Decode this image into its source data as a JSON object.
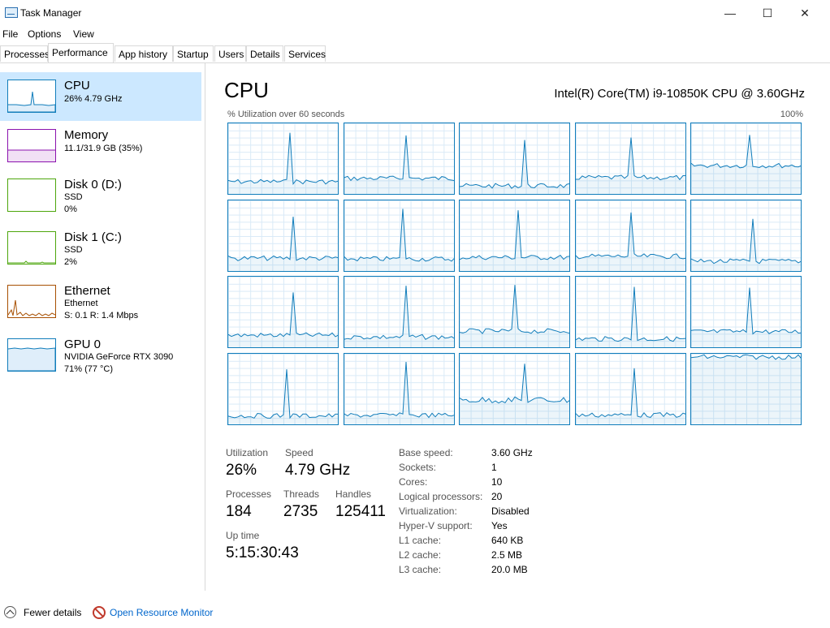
{
  "window": {
    "title": "Task Manager",
    "controls": [
      "—",
      "☐",
      "✕"
    ]
  },
  "menu": [
    "File",
    "Options",
    "View"
  ],
  "tabs": [
    "Processes",
    "Performance",
    "App history",
    "Startup",
    "Users",
    "Details",
    "Services"
  ],
  "active_tab": "Performance",
  "sidebar": [
    {
      "title": "CPU",
      "line1": "26%  4.79 GHz",
      "color": "#117dbb"
    },
    {
      "title": "Memory",
      "line1": "11.1/31.9 GB (35%)",
      "color": "#8b12ae"
    },
    {
      "title": "Disk 0 (D:)",
      "line1": "SSD",
      "line2": "0%",
      "color": "#4da60c"
    },
    {
      "title": "Disk 1 (C:)",
      "line1": "SSD",
      "line2": "2%",
      "color": "#4da60c"
    },
    {
      "title": "Ethernet",
      "line1": "Ethernet",
      "line2": "S: 0.1  R: 1.4 Mbps",
      "color": "#a74f01"
    },
    {
      "title": "GPU 0",
      "line1": "NVIDIA GeForce RTX 3090",
      "line2": "71% (77 °C)",
      "color": "#117dbb"
    }
  ],
  "main": {
    "heading": "CPU",
    "model": "Intel(R) Core(TM) i9-10850K CPU @ 3.60GHz",
    "util_caption": "% Utilization over 60 seconds",
    "max_label": "100%",
    "graph_color": "#117dbb",
    "cores": 20
  },
  "stats": {
    "utilization": {
      "label": "Utilization",
      "value": "26%"
    },
    "speed": {
      "label": "Speed",
      "value": "4.79 GHz"
    },
    "processes": {
      "label": "Processes",
      "value": "184"
    },
    "threads": {
      "label": "Threads",
      "value": "2735"
    },
    "handles": {
      "label": "Handles",
      "value": "125411"
    },
    "uptime": {
      "label": "Up time",
      "value": "5:15:30:43"
    }
  },
  "details": [
    {
      "label": "Base speed:",
      "value": "3.60 GHz"
    },
    {
      "label": "Sockets:",
      "value": "1"
    },
    {
      "label": "Cores:",
      "value": "10"
    },
    {
      "label": "Logical processors:",
      "value": "20"
    },
    {
      "label": "Virtualization:",
      "value": "Disabled"
    },
    {
      "label": "Hyper-V support:",
      "value": "Yes"
    },
    {
      "label": "L1 cache:",
      "value": "640 KB"
    },
    {
      "label": "L2 cache:",
      "value": "2.5 MB"
    },
    {
      "label": "L3 cache:",
      "value": "20.0 MB"
    }
  ],
  "footer": {
    "fewer": "Fewer details",
    "resmon": "Open Resource Monitor"
  },
  "icons": {
    "app": "task-manager-icon",
    "fewer": "chevron-up-icon",
    "resmon": "resource-monitor-icon"
  }
}
